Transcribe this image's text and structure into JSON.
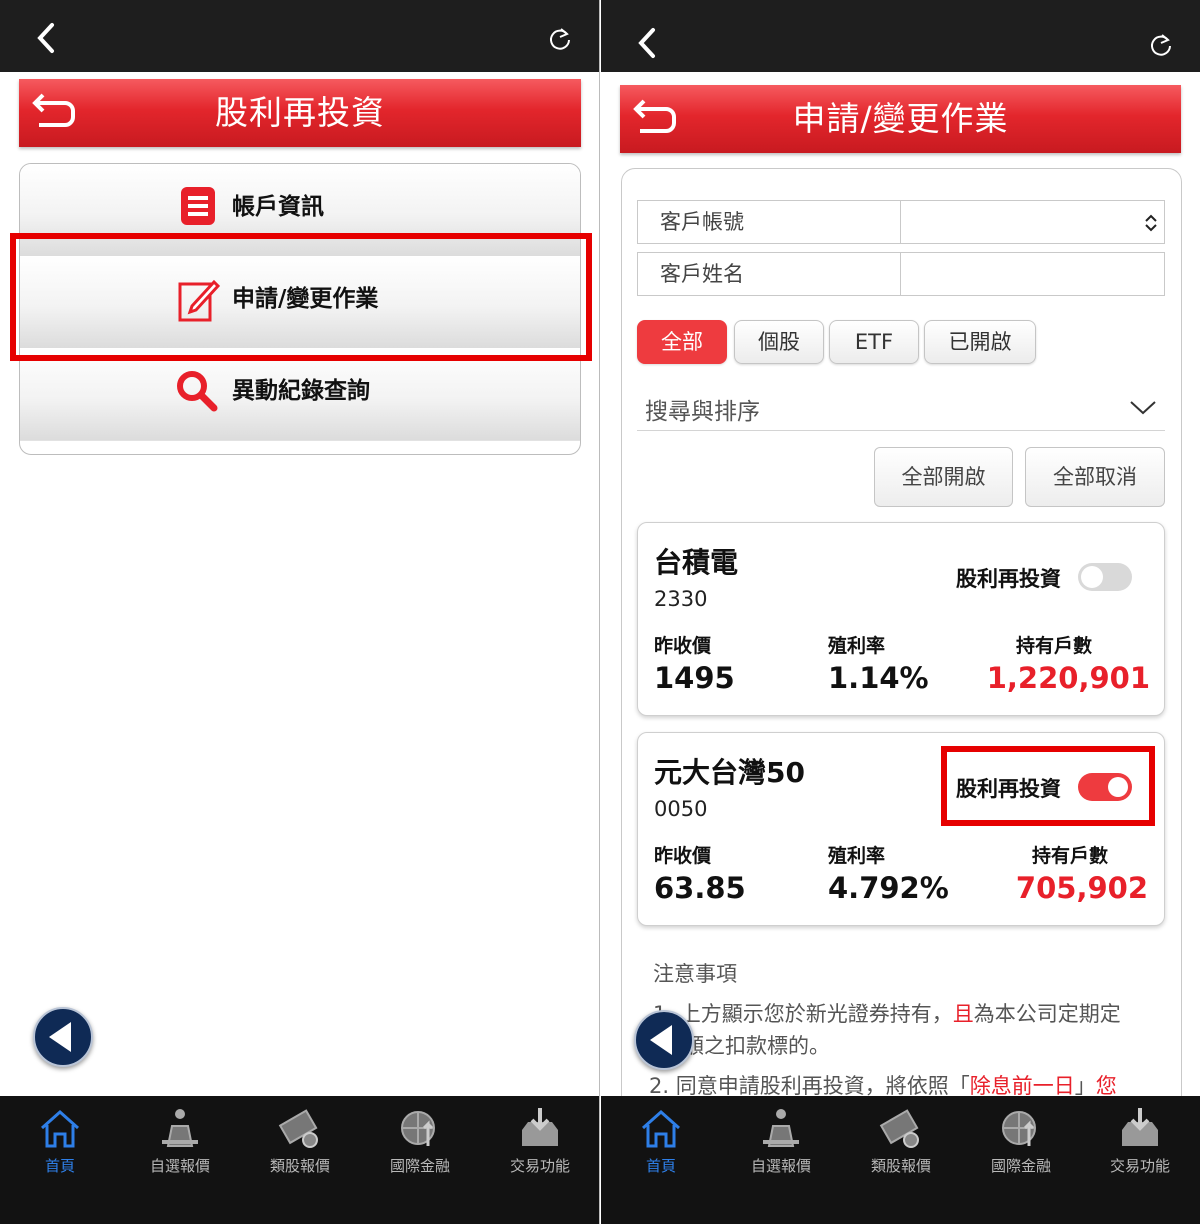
{
  "left": {
    "title": "股利再投資",
    "menu": [
      {
        "label": "帳戶資訊",
        "icon": "list-icon"
      },
      {
        "label": "申請/變更作業",
        "icon": "edit-icon"
      },
      {
        "label": "異動紀錄查詢",
        "icon": "search-icon"
      }
    ]
  },
  "right": {
    "title": "申請/變更作業",
    "fields": [
      {
        "label": "客戶帳號",
        "value": ""
      },
      {
        "label": "客戶姓名",
        "value": ""
      }
    ],
    "filters": [
      "全部",
      "個股",
      "ETF",
      "已開啟"
    ],
    "active_filter": "全部",
    "sort_label": "搜尋與排序",
    "actions": {
      "enable_all": "全部開啟",
      "cancel_all": "全部取消"
    },
    "stocks": [
      {
        "name": "台積電",
        "code": "2330",
        "drip_label": "股利再投資",
        "drip_on": false,
        "close_label": "昨收價",
        "close": "1495",
        "yield_label": "殖利率",
        "yield": "1.14%",
        "holders_label": "持有戶數",
        "holders": "1,220,901"
      },
      {
        "name": "元大台灣50",
        "code": "0050",
        "drip_label": "股利再投資",
        "drip_on": true,
        "close_label": "昨收價",
        "close": "63.85",
        "yield_label": "殖利率",
        "yield": "4.792%",
        "holders_label": "持有戶數",
        "holders": "705,902"
      }
    ],
    "notes": {
      "title": "注意事項",
      "n1_a": "1. 上方顯示您於新光證券持有，",
      "n1_red": "且",
      "n1_b": "為本公司定期定",
      "n1_c": "額之扣款標的。",
      "n2_a": "2. 同意申請股利再投資，將依照「",
      "n2_red": "除息前一日",
      "n2_b": "」",
      "n2_red2": "您"
    }
  },
  "tabbar": [
    {
      "label": "首頁",
      "icon": "home-icon",
      "active": true
    },
    {
      "label": "自選報價",
      "icon": "watchlist-icon",
      "active": false
    },
    {
      "label": "類股報價",
      "icon": "sector-quote-icon",
      "active": false
    },
    {
      "label": "國際金融",
      "icon": "globe-icon",
      "active": false
    },
    {
      "label": "交易功能",
      "icon": "trade-icon",
      "active": false
    }
  ],
  "colors": {
    "accent_red": "#e8202a",
    "tab_active": "#2e7fe8",
    "topbar": "#1e1e1e",
    "fab": "#0f2a55"
  }
}
